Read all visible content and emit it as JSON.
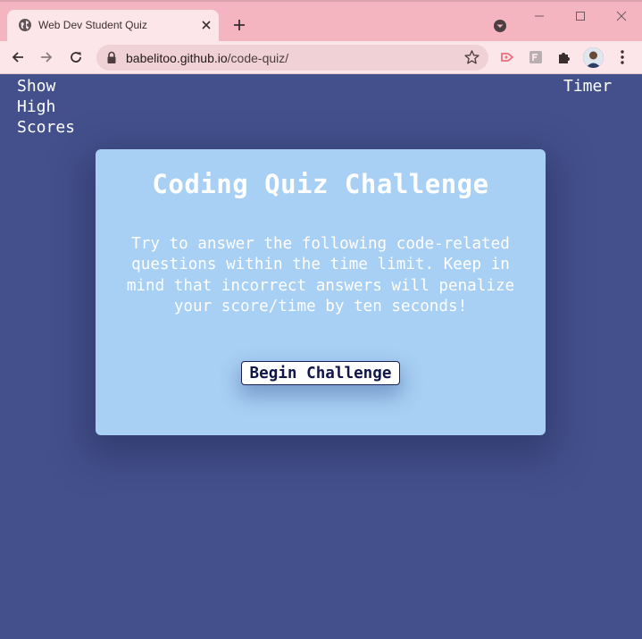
{
  "browser": {
    "tab_title": "Web Dev Student Quiz",
    "url_host": "babelitoo.github.io",
    "url_path": "/code-quiz/"
  },
  "page": {
    "highscores_link": "Show High Scores",
    "timer_label": "Timer",
    "card": {
      "title": "Coding Quiz Challenge",
      "description": "Try to answer the following code-related questions within the time limit. Keep in mind that incorrect answers will penalize your score/time by ten seconds!",
      "begin_label": "Begin Challenge"
    }
  },
  "colors": {
    "page_background": "#43508b",
    "card_background": "#a8cff4",
    "titlebar": "#f4b5c0",
    "toolbar": "#fde6ea",
    "button_text": "#10164a"
  },
  "icons": [
    "globe-icon",
    "close-icon",
    "plus-icon",
    "tab-search-icon",
    "minimize-icon",
    "maximize-icon",
    "window-close-icon",
    "back-arrow-icon",
    "forward-arrow-icon",
    "reload-icon",
    "lock-icon",
    "star-icon",
    "extension-icon",
    "puzzle-icon",
    "kebab-menu-icon"
  ]
}
